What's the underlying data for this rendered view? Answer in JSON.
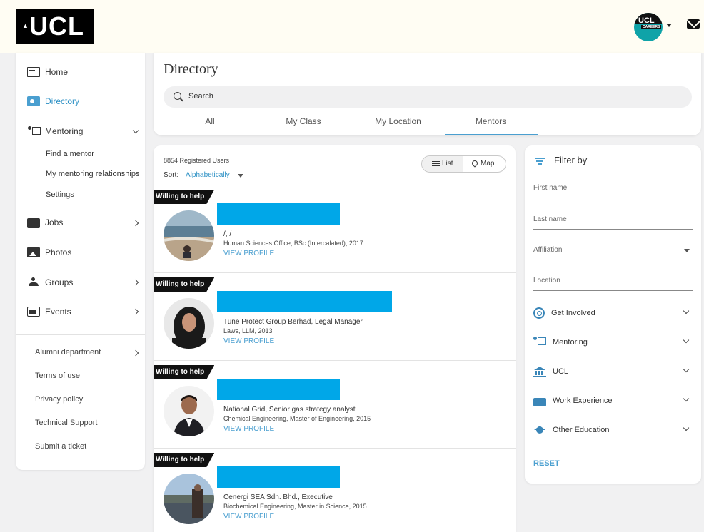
{
  "header": {
    "logo_text": "UCL",
    "avatar_text": "UCL",
    "avatar_subtext": "CAREERS",
    "icons": [
      "ucl-logo",
      "user-avatar",
      "caret-down-icon",
      "mail-icon"
    ]
  },
  "sidebar": {
    "items": [
      {
        "label": "Home",
        "icon": "home-icon"
      },
      {
        "label": "Directory",
        "icon": "directory-icon"
      },
      {
        "label": "Mentoring",
        "icon": "mentoring-icon"
      },
      {
        "label": "Jobs",
        "icon": "jobs-icon"
      },
      {
        "label": "Photos",
        "icon": "photos-icon"
      },
      {
        "label": "Groups",
        "icon": "groups-icon"
      },
      {
        "label": "Events",
        "icon": "events-icon"
      }
    ],
    "mentoring_sub": [
      "Find a mentor",
      "My mentoring relationships",
      "Settings"
    ],
    "footer": [
      "Alumni department",
      "Terms of use",
      "Privacy policy",
      "Technical Support",
      "Submit a ticket"
    ]
  },
  "directory": {
    "title": "Directory",
    "search_placeholder": "Search",
    "tabs": [
      "All",
      "My Class",
      "My Location",
      "Mentors"
    ],
    "active_tab": "Mentors"
  },
  "list": {
    "registered": "8854 Registered Users",
    "sort_label": "Sort:",
    "sort_value": "Alphabetically",
    "view_list": "List",
    "view_map": "Map",
    "badge": "Willing to help",
    "view_profile": "VIEW PROFILE",
    "results": [
      {
        "line1": "/, /",
        "line2": "Human Sciences Office, BSc (Intercalated), 2017"
      },
      {
        "line1": "Tune Protect Group Berhad, Legal Manager",
        "line2": "Laws, LLM, 2013"
      },
      {
        "line1": "National Grid, Senior gas strategy analyst",
        "line2": "Chemical Engineering, Master of Engineering, 2015"
      },
      {
        "line1": "Cenergi SEA Sdn. Bhd., Executive",
        "line2": "Biochemical Engineering, Master in Science, 2015"
      }
    ]
  },
  "filter": {
    "title": "Filter by",
    "fields": [
      "First name",
      "Last name",
      "Affiliation",
      "Location"
    ],
    "sections": [
      "Get Involved",
      "Mentoring",
      "UCL",
      "Work Experience",
      "Other Education"
    ],
    "reset": "RESET"
  },
  "colors": {
    "accent": "#4a9fd0",
    "link": "#2a8fc4",
    "redaction": "#00a7e8",
    "badge": "#111111",
    "header_bg": "#fffdf3"
  }
}
